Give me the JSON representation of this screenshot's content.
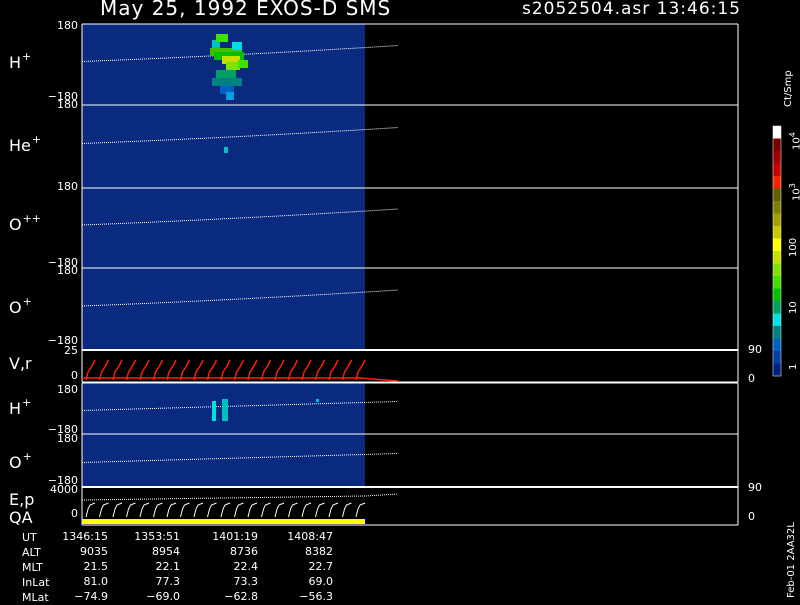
{
  "header": {
    "title": "May 25, 1992   EXOS-D SMS",
    "file": "s2052504.asr  13:46:15"
  },
  "colorbar": {
    "unit": "Ct/Smp",
    "ticks": [
      "10",
      "10",
      "10",
      "100",
      "10",
      "1"
    ],
    "tick_powers": [
      "4",
      "3",
      "",
      "",
      "",
      ""
    ],
    "colors": [
      "#ffffff",
      "#7a0000",
      "#a00000",
      "#c80000",
      "#ff2000",
      "#606000",
      "#808000",
      "#a0a000",
      "#c8c800",
      "#ffff00",
      "#c8e000",
      "#80e000",
      "#40e000",
      "#00c000",
      "#00a060",
      "#00e0e0",
      "#008080",
      "#0060c0",
      "#0040a0",
      "#002080"
    ]
  },
  "panels": [
    {
      "ion": "H",
      "charge": "+",
      "top_label": "180",
      "bottom_label": "−180"
    },
    {
      "ion": "He",
      "charge": "+",
      "top_label": "180",
      "bottom_label": ""
    },
    {
      "ion": "O",
      "charge": "++",
      "top_label": "180",
      "bottom_label": "−180"
    },
    {
      "ion": "O",
      "charge": "+",
      "top_label": "180",
      "bottom_label": "−180"
    }
  ],
  "vr_panel": {
    "label": "V,r",
    "top_label": "25",
    "bottom_label": "0",
    "right_top": "90",
    "right_bottom": "0"
  },
  "lower_panels": [
    {
      "ion": "H",
      "charge": "+",
      "top_label": "180",
      "bottom_label": "−180"
    },
    {
      "ion": "O",
      "charge": "+",
      "top_label": "180",
      "bottom_label": "−180"
    }
  ],
  "ep_panel": {
    "label": "E,p",
    "qa_label": "QA",
    "top_label": "4000",
    "bottom_label": "0",
    "right_top": "90",
    "right_bottom": "0"
  },
  "footer": {
    "rows": [
      {
        "label": "UT",
        "values": [
          "1346:15",
          "1353:51",
          "1401:19",
          "1408:47"
        ]
      },
      {
        "label": "ALT",
        "values": [
          "9035",
          "8954",
          "8736",
          "8382"
        ]
      },
      {
        "label": "MLT",
        "values": [
          "21.5",
          "22.1",
          "22.4",
          "22.7"
        ]
      },
      {
        "label": "InLat",
        "values": [
          "81.0",
          "77.3",
          "73.3",
          "69.0"
        ]
      },
      {
        "label": "MLat",
        "values": [
          "−74.9",
          "−69.0",
          "−62.8",
          "−56.3"
        ]
      }
    ],
    "side_stamp": "Feb-01 2AA32L"
  },
  "chart_data": {
    "type": "heatmap",
    "title": "May 25, 1992   EXOS-D SMS",
    "x": [
      "1346:15",
      "1353:51",
      "1401:19",
      "1408:47"
    ],
    "series": [
      {
        "name": "H+",
        "ylim": [
          -180,
          180
        ]
      },
      {
        "name": "He+",
        "ylim": [
          -180,
          180
        ]
      },
      {
        "name": "O++",
        "ylim": [
          -180,
          180
        ]
      },
      {
        "name": "O+",
        "ylim": [
          -180,
          180
        ]
      },
      {
        "name": "V,r",
        "ylim": [
          0,
          25
        ]
      },
      {
        "name": "H+",
        "ylim": [
          -180,
          180
        ]
      },
      {
        "name": "O+",
        "ylim": [
          -180,
          180
        ]
      },
      {
        "name": "E,p",
        "ylim": [
          0,
          4000
        ]
      }
    ],
    "colorbar_unit": "Ct/Smp",
    "colorbar_range": [
      1,
      10000
    ],
    "colorbar_scale": "log"
  }
}
